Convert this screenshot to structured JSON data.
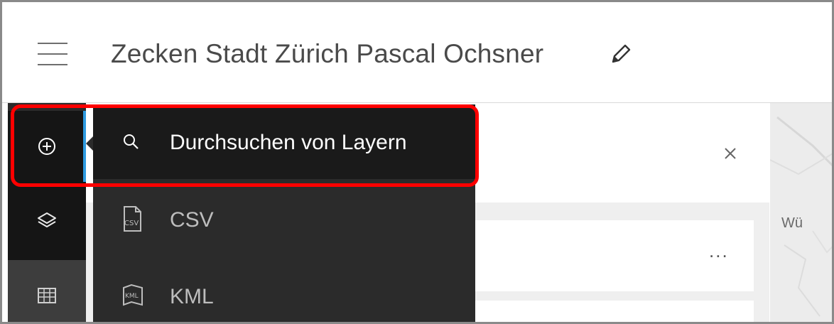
{
  "header": {
    "title": "Zecken Stadt Zürich Pascal Ochsner"
  },
  "rail": {
    "items": [
      {
        "icon": "add-circle-icon"
      },
      {
        "icon": "layers-icon"
      },
      {
        "icon": "table-icon"
      }
    ]
  },
  "add_menu": {
    "items": [
      {
        "label": "Durchsuchen von Layern",
        "icon": "search-icon"
      },
      {
        "label": "CSV",
        "icon": "csv-file-icon"
      },
      {
        "label": "KML",
        "icon": "kml-file-icon"
      }
    ]
  },
  "panel": {
    "more_label": "...",
    "close_icon": "close-icon"
  },
  "map": {
    "label": "Wü"
  },
  "colors": {
    "highlight": "#ff0000",
    "accent": "#2f9be0",
    "menu_bg": "#2b2b2b"
  }
}
